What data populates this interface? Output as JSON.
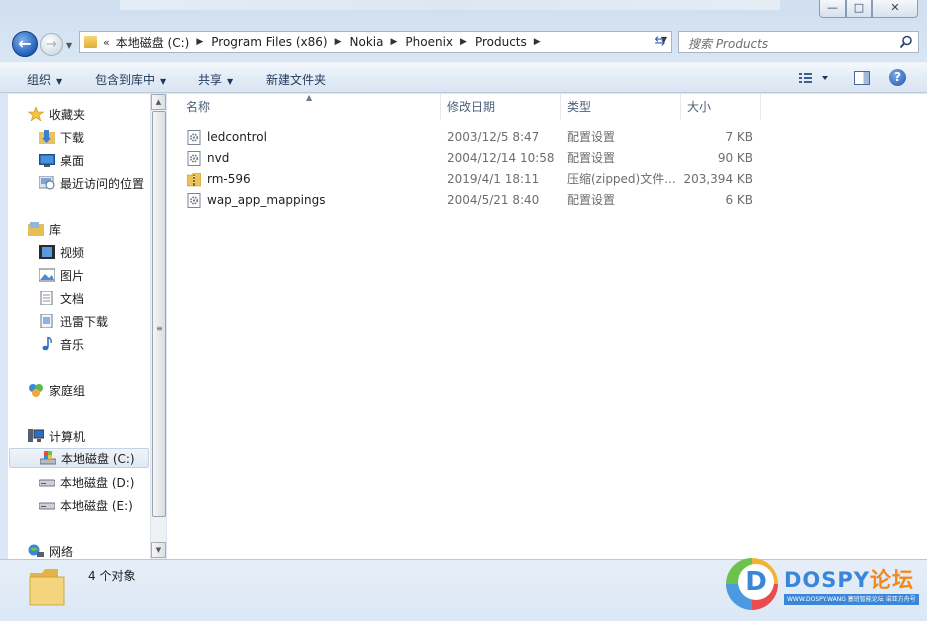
{
  "window": {
    "controls": {
      "minimize": "—",
      "maximize": "□",
      "close": "✕"
    }
  },
  "nav": {
    "back": "←",
    "forward": "→"
  },
  "address": {
    "overflow": "«",
    "crumbs": [
      "本地磁盘 (C:)",
      "Program Files (x86)",
      "Nokia",
      "Phoenix",
      "Products"
    ]
  },
  "search": {
    "placeholder": "搜索 Products"
  },
  "toolbar": {
    "organize": "组织",
    "include_in_library": "包含到库中",
    "share": "共享",
    "new_folder": "新建文件夹",
    "help": "?"
  },
  "sidebar": {
    "favorites": {
      "label": "收藏夹",
      "items": [
        "下载",
        "桌面",
        "最近访问的位置"
      ]
    },
    "libraries": {
      "label": "库",
      "items": [
        "视频",
        "图片",
        "文档",
        "迅雷下载",
        "音乐"
      ]
    },
    "homegroup": "家庭组",
    "computer": {
      "label": "计算机",
      "items": [
        "本地磁盘 (C:)",
        "本地磁盘 (D:)",
        "本地磁盘 (E:)"
      ],
      "selected": "本地磁盘 (C:)"
    },
    "network": "网络"
  },
  "columns": {
    "name": "名称",
    "date": "修改日期",
    "type": "类型",
    "size": "大小"
  },
  "files": [
    {
      "name": "ledcontrol",
      "date": "2003/12/5 8:47",
      "type": "配置设置",
      "size": "7 KB",
      "icon": "config-file-icon"
    },
    {
      "name": "nvd",
      "date": "2004/12/14 10:58",
      "type": "配置设置",
      "size": "90 KB",
      "icon": "config-file-icon"
    },
    {
      "name": "rm-596",
      "date": "2019/4/1 18:11",
      "type": "压缩(zipped)文件...",
      "size": "203,394 KB",
      "icon": "zip-folder-icon"
    },
    {
      "name": "wap_app_mappings",
      "date": "2004/5/21 8:40",
      "type": "配置设置",
      "size": "6 KB",
      "icon": "config-file-icon"
    }
  ],
  "status": {
    "count": "4 个对象"
  },
  "watermark": {
    "logo_letter": "D",
    "title_latin": "DOSPY",
    "title_cn": "论坛",
    "subtitle": "WWW.DOSPY.WANG 塞班智能论坛 诺亚方舟号"
  },
  "colors": {
    "accent": "#3a86d8",
    "toolbar_text": "#1e395b",
    "header_text": "#4c607a"
  }
}
